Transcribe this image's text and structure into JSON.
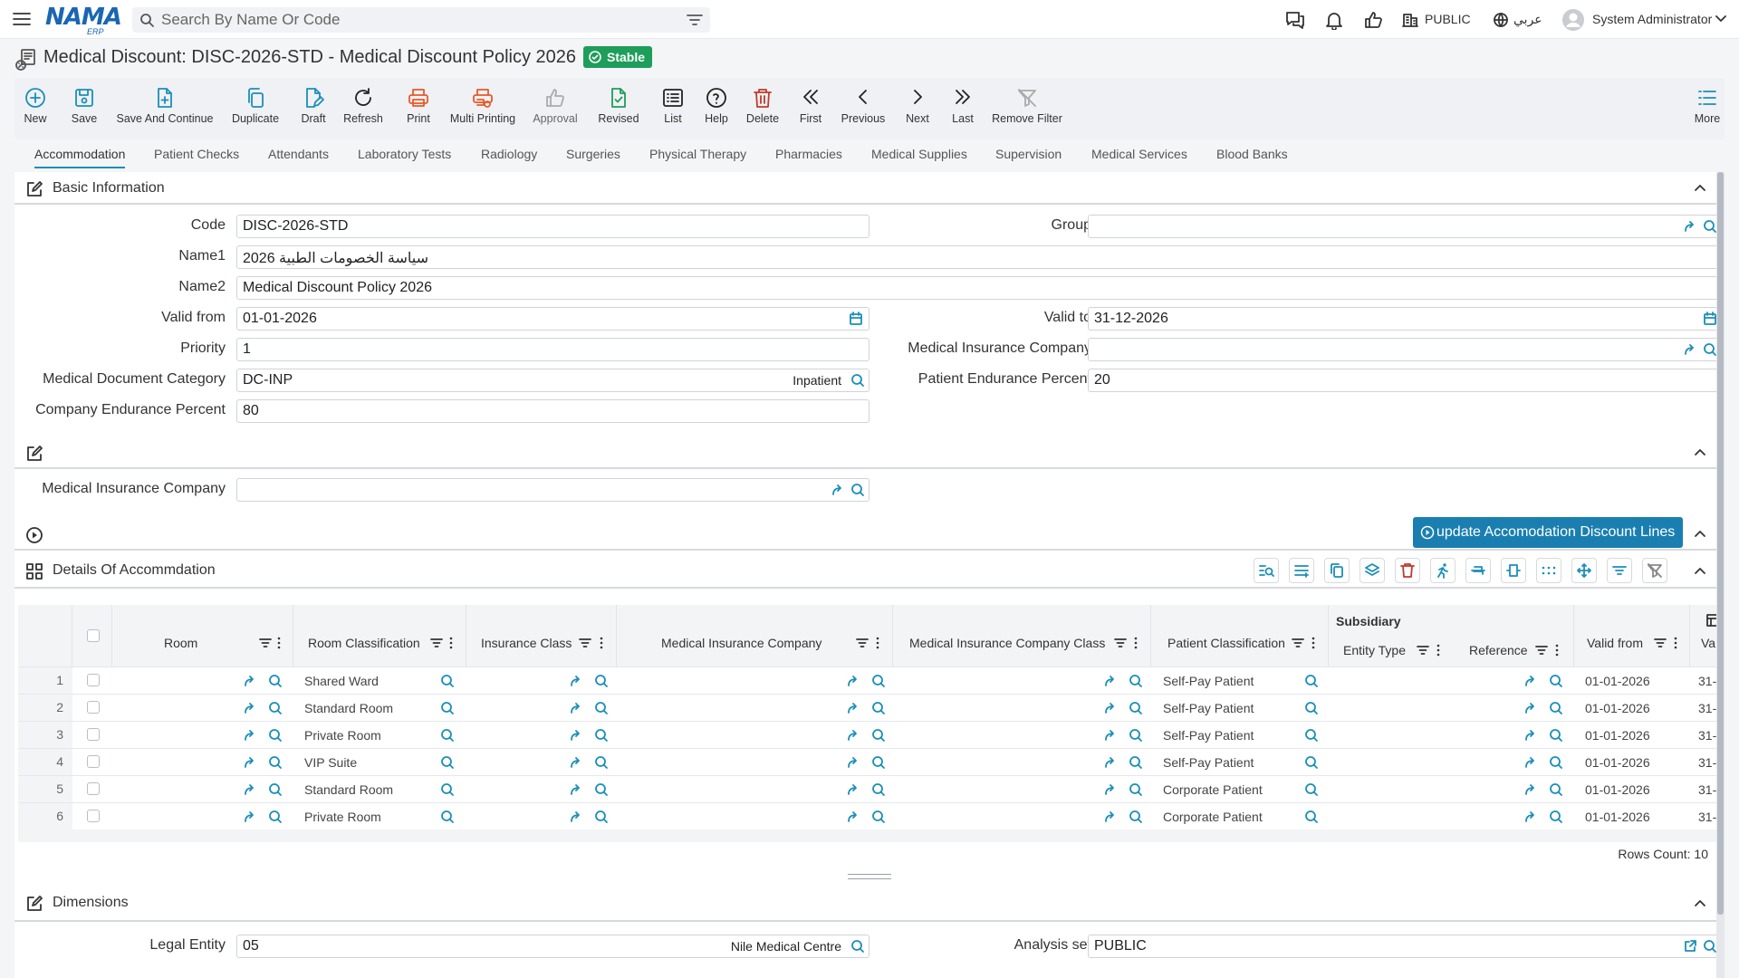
{
  "header": {
    "logo": "NAMA",
    "logo_sub": "ERP",
    "search_placeholder": "Search By Name Or Code",
    "analysis_set": "PUBLIC",
    "language": "عربي",
    "user": "System Administrator",
    "icons": [
      "menu-icon",
      "search-icon",
      "filter-icon",
      "chat-icon",
      "bell-icon",
      "thumbs-up-icon",
      "building-icon",
      "globe-icon",
      "user-icon",
      "chevron-down-icon"
    ]
  },
  "title": {
    "text": "Medical Discount: DISC-2026-STD - Medical Discount Policy 2026",
    "status": "Stable",
    "status_color": "#1e9e5a"
  },
  "toolbar": {
    "new": "New",
    "save": "Save",
    "save_continue": "Save And Continue",
    "duplicate": "Duplicate",
    "draft": "Draft",
    "refresh": "Refresh",
    "print": "Print",
    "multi_printing": "Multi Printing",
    "approval": "Approval",
    "revised": "Revised",
    "list": "List",
    "help": "Help",
    "delete": "Delete",
    "first": "First",
    "previous": "Previous",
    "next": "Next",
    "last": "Last",
    "remove_filter": "Remove Filter",
    "more": "More"
  },
  "tabs": [
    "Accommodation",
    "Patient Checks",
    "Attendants",
    "Laboratory Tests",
    "Radiology",
    "Surgeries",
    "Physical Therapy",
    "Pharmacies",
    "Medical Supplies",
    "Supervision",
    "Medical Services",
    "Blood Banks"
  ],
  "basic": {
    "title": "Basic Information",
    "code_label": "Code",
    "code": "DISC-2026-STD",
    "group_label": "Group",
    "group": "",
    "name1_label": "Name1",
    "name1": "2026 سياسة الخصومات الطبية",
    "name2_label": "Name2",
    "name2": "Medical Discount Policy 2026",
    "valid_from_label": "Valid from",
    "valid_from": "01-01-2026",
    "valid_to_label": "Valid to",
    "valid_to": "31-12-2026",
    "priority_label": "Priority",
    "priority": "1",
    "med_ins_company_label": "Medical Insurance Company",
    "med_ins_company": "",
    "med_doc_cat_label": "Medical Document Category",
    "med_doc_cat": "DC-INP",
    "med_doc_cat_name": "Inpatient",
    "patient_endurance_label": "Patient Endurance Percent",
    "patient_endurance": "20",
    "company_endurance_label": "Company Endurance Percent",
    "company_endurance": "80"
  },
  "section2": {
    "med_ins_company_label": "Medical Insurance Company",
    "med_ins_company": ""
  },
  "update_button": "update Accomodation Discount Lines",
  "details": {
    "title": "Details Of Accommdation",
    "columns": {
      "room": "Room",
      "room_class": "Room Classification",
      "ins_class": "Insurance Class",
      "med_ins_company": "Medical Insurance Company",
      "med_ins_company_class": "Medical Insurance Company Class",
      "patient_class": "Patient Classification",
      "subsidiary": "Subsidiary",
      "entity_type": "Entity Type",
      "reference": "Reference",
      "valid_from": "Valid from",
      "valid_to_cut": "Va"
    },
    "rows": [
      {
        "n": "1",
        "room_class": "Shared Ward",
        "patient_class": "Self-Pay Patient",
        "valid_from": "01-01-2026",
        "valid_to": "31-"
      },
      {
        "n": "2",
        "room_class": "Standard Room",
        "patient_class": "Self-Pay Patient",
        "valid_from": "01-01-2026",
        "valid_to": "31-"
      },
      {
        "n": "3",
        "room_class": "Private Room",
        "patient_class": "Self-Pay Patient",
        "valid_from": "01-01-2026",
        "valid_to": "31-"
      },
      {
        "n": "4",
        "room_class": "VIP Suite",
        "patient_class": "Self-Pay Patient",
        "valid_from": "01-01-2026",
        "valid_to": "31-"
      },
      {
        "n": "5",
        "room_class": "Standard Room",
        "patient_class": "Corporate Patient",
        "valid_from": "01-01-2026",
        "valid_to": "31-"
      },
      {
        "n": "6",
        "room_class": "Private Room",
        "patient_class": "Corporate Patient",
        "valid_from": "01-01-2026",
        "valid_to": "31-"
      }
    ],
    "rows_count": "Rows Count: 10"
  },
  "dimensions": {
    "title": "Dimensions",
    "legal_entity_label": "Legal Entity",
    "legal_entity": "05",
    "legal_entity_name": "Nile Medical Centre",
    "analysis_set_label": "Analysis set",
    "analysis_set": "PUBLIC"
  },
  "colors": {
    "accent": "#1a8fb8",
    "primary_button": "#1a7fb0",
    "brand": "#1a66b3"
  }
}
